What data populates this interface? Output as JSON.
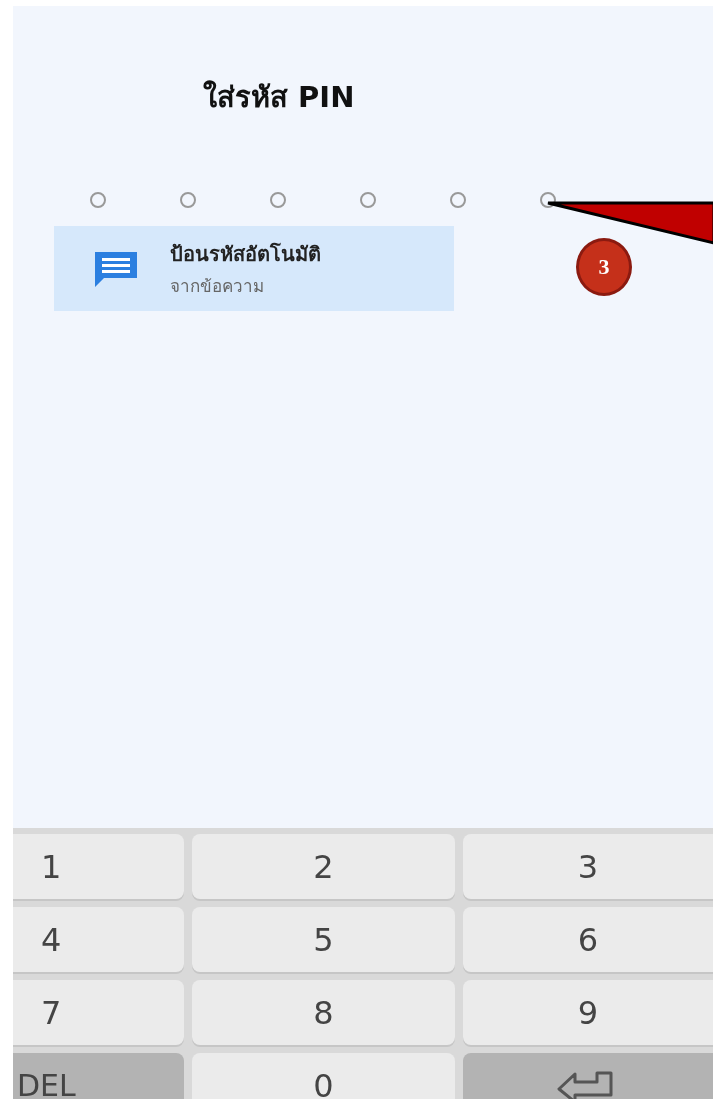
{
  "title": "ใส่รหัส PIN",
  "pin_dots": [
    {
      "filled": false
    },
    {
      "filled": false
    },
    {
      "filled": false
    },
    {
      "filled": false
    },
    {
      "filled": false
    },
    {
      "filled": false
    }
  ],
  "autofill": {
    "title": "ป้อนรหัสอัตโนมัติ",
    "subtitle": "จากข้อความ"
  },
  "annotation": {
    "number": "3"
  },
  "keypad": [
    {
      "label": "1",
      "kind": "digit"
    },
    {
      "label": "2",
      "kind": "digit"
    },
    {
      "label": "3",
      "kind": "digit"
    },
    {
      "label": "4",
      "kind": "digit"
    },
    {
      "label": "5",
      "kind": "digit"
    },
    {
      "label": "6",
      "kind": "digit"
    },
    {
      "label": "7",
      "kind": "digit"
    },
    {
      "label": "8",
      "kind": "digit"
    },
    {
      "label": "9",
      "kind": "digit"
    },
    {
      "label": "DEL",
      "kind": "delete"
    },
    {
      "label": "0",
      "kind": "digit"
    },
    {
      "kind": "enter"
    }
  ]
}
